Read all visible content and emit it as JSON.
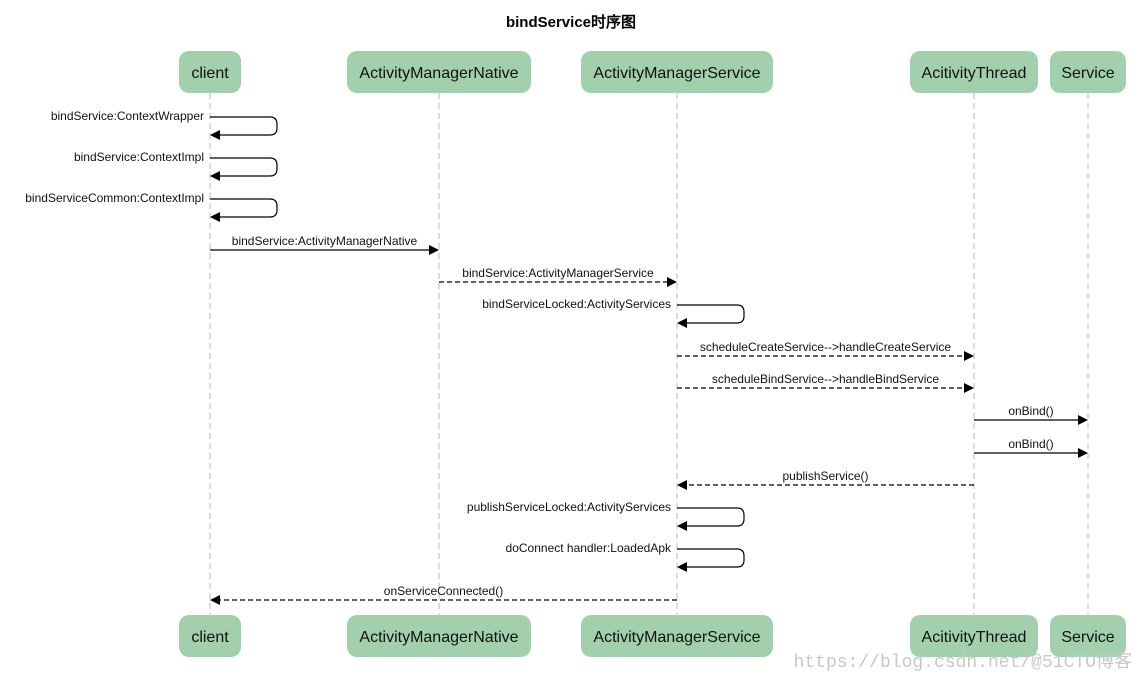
{
  "title": "bindService时序图",
  "actors": [
    {
      "id": "client",
      "label": "client"
    },
    {
      "id": "amn",
      "label": "ActivityManagerNative"
    },
    {
      "id": "ams",
      "label": "ActivityManagerService"
    },
    {
      "id": "at",
      "label": "AcitivityThread"
    },
    {
      "id": "service",
      "label": "Service"
    }
  ],
  "messages": [
    {
      "from": "client",
      "to": "client",
      "label": "bindService:ContextWrapper",
      "style": "solid"
    },
    {
      "from": "client",
      "to": "client",
      "label": "bindService:ContextImpl",
      "style": "solid"
    },
    {
      "from": "client",
      "to": "client",
      "label": "bindServiceCommon:ContextImpl",
      "style": "solid"
    },
    {
      "from": "client",
      "to": "amn",
      "label": "bindService:ActivityManagerNative",
      "style": "solid"
    },
    {
      "from": "amn",
      "to": "ams",
      "label": "bindService:ActivityManagerService",
      "style": "dashed"
    },
    {
      "from": "ams",
      "to": "ams",
      "label": "bindServiceLocked:ActivityServices",
      "style": "solid"
    },
    {
      "from": "ams",
      "to": "at",
      "label": "scheduleCreateService-->handleCreateService",
      "style": "dashed"
    },
    {
      "from": "ams",
      "to": "at",
      "label": "scheduleBindService-->handleBindService",
      "style": "dashed"
    },
    {
      "from": "at",
      "to": "service",
      "label": "onBind()",
      "style": "solid"
    },
    {
      "from": "at",
      "to": "service",
      "label": "onBind()",
      "style": "solid"
    },
    {
      "from": "at",
      "to": "ams",
      "label": "publishService()",
      "style": "dashed"
    },
    {
      "from": "ams",
      "to": "ams",
      "label": "publishServiceLocked:ActivityServices",
      "style": "solid"
    },
    {
      "from": "ams",
      "to": "ams",
      "label": "doConnect handler:LoadedApk",
      "style": "solid"
    },
    {
      "from": "ams",
      "to": "client",
      "label": "onServiceConnected()",
      "style": "dashed"
    }
  ],
  "watermark": "https://blog.csdn.net/@51CTO博客"
}
